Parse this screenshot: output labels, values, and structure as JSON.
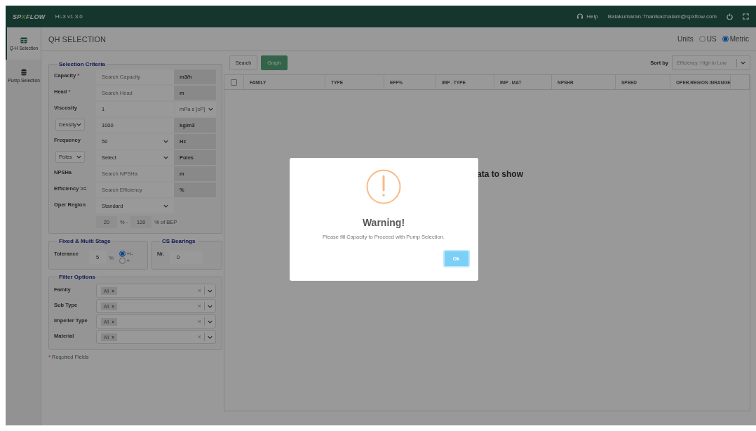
{
  "header": {
    "logo": [
      "SP",
      "X",
      "FLOW"
    ],
    "version": "HI-3 v1.3.0",
    "help": "Help",
    "user": "Balakumaran.Thanikachalam@spxflow.com"
  },
  "sidebar": {
    "items": [
      {
        "kind": "grid",
        "label": "Q-H Selection",
        "selected": true
      },
      {
        "kind": "database",
        "label": "Pump Selection",
        "selected": false
      }
    ]
  },
  "page_title": "QH SELECTION",
  "units": {
    "label": "Units",
    "options": [
      {
        "label": "US",
        "selected": false
      },
      {
        "label": "Metric",
        "selected": true
      }
    ]
  },
  "required_mark": "*",
  "selection_criteria": {
    "title": "Selection Criteria",
    "rows": [
      {
        "kind": "field",
        "label": {
          "kind": "text",
          "text": "Capacity"
        },
        "required": true,
        "field": {
          "kind": "input",
          "placeholder": "Search Capacity"
        },
        "unit": {
          "kind": "addon",
          "text": "m3/h"
        }
      },
      {
        "kind": "field",
        "label": {
          "kind": "text",
          "text": "Head"
        },
        "required": true,
        "field": {
          "kind": "input",
          "placeholder": "Search Head"
        },
        "unit": {
          "kind": "addon",
          "text": "m"
        }
      },
      {
        "kind": "field",
        "label": {
          "kind": "text",
          "text": "Viscosity"
        },
        "required": false,
        "field": {
          "kind": "input",
          "value": "1"
        },
        "unit": {
          "kind": "select",
          "text": "mPa s [cP]"
        }
      },
      {
        "kind": "field",
        "label": {
          "kind": "select",
          "text": "Density"
        },
        "required": false,
        "field": {
          "kind": "input",
          "value": "1000"
        },
        "unit": {
          "kind": "addon",
          "text": "kg/m3"
        }
      },
      {
        "kind": "field",
        "label": {
          "kind": "text",
          "text": "Frequency"
        },
        "required": false,
        "field": {
          "kind": "select",
          "value": "50"
        },
        "unit": {
          "kind": "addon",
          "text": "Hz"
        }
      },
      {
        "kind": "field",
        "label": {
          "kind": "select",
          "text": "Poles"
        },
        "required": false,
        "field": {
          "kind": "select",
          "value": "Select"
        },
        "unit": {
          "kind": "addon",
          "text": "Poles"
        }
      },
      {
        "kind": "field",
        "label": {
          "kind": "text",
          "text": "NPSHa"
        },
        "required": false,
        "field": {
          "kind": "input",
          "placeholder": "Search NPSHa"
        },
        "unit": {
          "kind": "addon",
          "text": "m"
        }
      },
      {
        "kind": "field",
        "label": {
          "kind": "text",
          "text": "Efficiency >="
        },
        "required": false,
        "field": {
          "kind": "input",
          "placeholder": "Search Efficiency"
        },
        "unit": {
          "kind": "addon",
          "text": "%"
        }
      },
      {
        "kind": "field",
        "label": {
          "kind": "text",
          "text": "Oper Region"
        },
        "required": false,
        "field": {
          "kind": "select",
          "value": "Standard"
        }
      },
      {
        "kind": "range",
        "from": "20",
        "separator": "% -",
        "to": "120",
        "suffix": "% of BEP"
      }
    ]
  },
  "fixed_multi_stage": {
    "title": "Fixed & Multi Stage",
    "label": "Tolerance",
    "value": "5",
    "unit": "%",
    "options": [
      {
        "label": "+/-",
        "selected": true
      },
      {
        "label": "+",
        "selected": false
      }
    ]
  },
  "cs_bearings": {
    "title": "CS Bearings",
    "label": "Nr.",
    "value": "0"
  },
  "filter_options": {
    "title": "Filter Options",
    "rows": [
      {
        "label": "Family",
        "chip": "All",
        "chip_remove": "×",
        "clear": "×"
      },
      {
        "label": "Sub Type",
        "chip": "All",
        "chip_remove": "×",
        "clear": "×"
      },
      {
        "label": "Impeller Type",
        "chip": "All",
        "chip_remove": "×",
        "clear": "×"
      },
      {
        "label": "Material",
        "chip": "All",
        "chip_remove": "×",
        "clear": "×"
      }
    ]
  },
  "required_note": "Required Fields",
  "toolbar": {
    "buttons": [
      {
        "kind": "default",
        "label": "Search"
      },
      {
        "kind": "primary",
        "label": "Graph"
      }
    ],
    "sort_label": "Sort by",
    "sort_value": "Efficiency: High to Low"
  },
  "table": {
    "select_all_checked": false,
    "columns": [
      "FAMILY",
      "TYPE",
      "EFF%",
      "IMP . TYPE",
      "IMP . MAT",
      "NPSHR",
      "SPEED",
      "OPER.REGION INRANGE"
    ],
    "empty_text": "ata to show"
  },
  "dialog": {
    "title": "Warning!",
    "message": "Please fill Capacity to Proceed with Pump Selection.",
    "button": "Ok"
  }
}
